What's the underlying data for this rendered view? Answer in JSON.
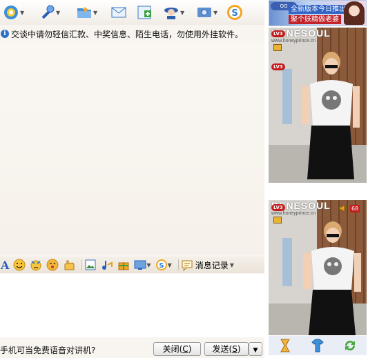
{
  "notice": "交谈中请勿轻信汇款、中奖信息、陌生电话，勿使用外挂软件。",
  "format_bar": {
    "font_label": "A",
    "history_label": "消息记录"
  },
  "bottom": {
    "tip": "手机可当免费语音对讲机?",
    "close_label": "关闭(C)",
    "close_text": "关闭(",
    "close_key": "C",
    "send_text": "发送(",
    "send_key": "S",
    "paren_close": ")"
  },
  "banner": {
    "line1": "全新版本今日推出",
    "line2": "聚个妖精做老婆"
  },
  "video": {
    "watermark": "BENESOUL",
    "watermark_url": "www.honeyprince.cn",
    "level_badge": "LV3",
    "volume_badge": "68"
  },
  "colors": {
    "accent": "#2f6fc9",
    "window_bg": "#f8f4ef",
    "badge_red": "#c41b1b"
  },
  "icons": [
    "qq-avatar-icon",
    "microphone-icon",
    "folder-icon",
    "mail-icon",
    "add-icon",
    "contact-icon",
    "settings-icon",
    "soso-icon",
    "smiley-icon",
    "magic-icon",
    "wink-icon",
    "hand-icon",
    "image-icon",
    "music-icon",
    "gift-icon",
    "screen-icon",
    "hourglass-icon",
    "shirt-icon",
    "refresh-icon"
  ]
}
